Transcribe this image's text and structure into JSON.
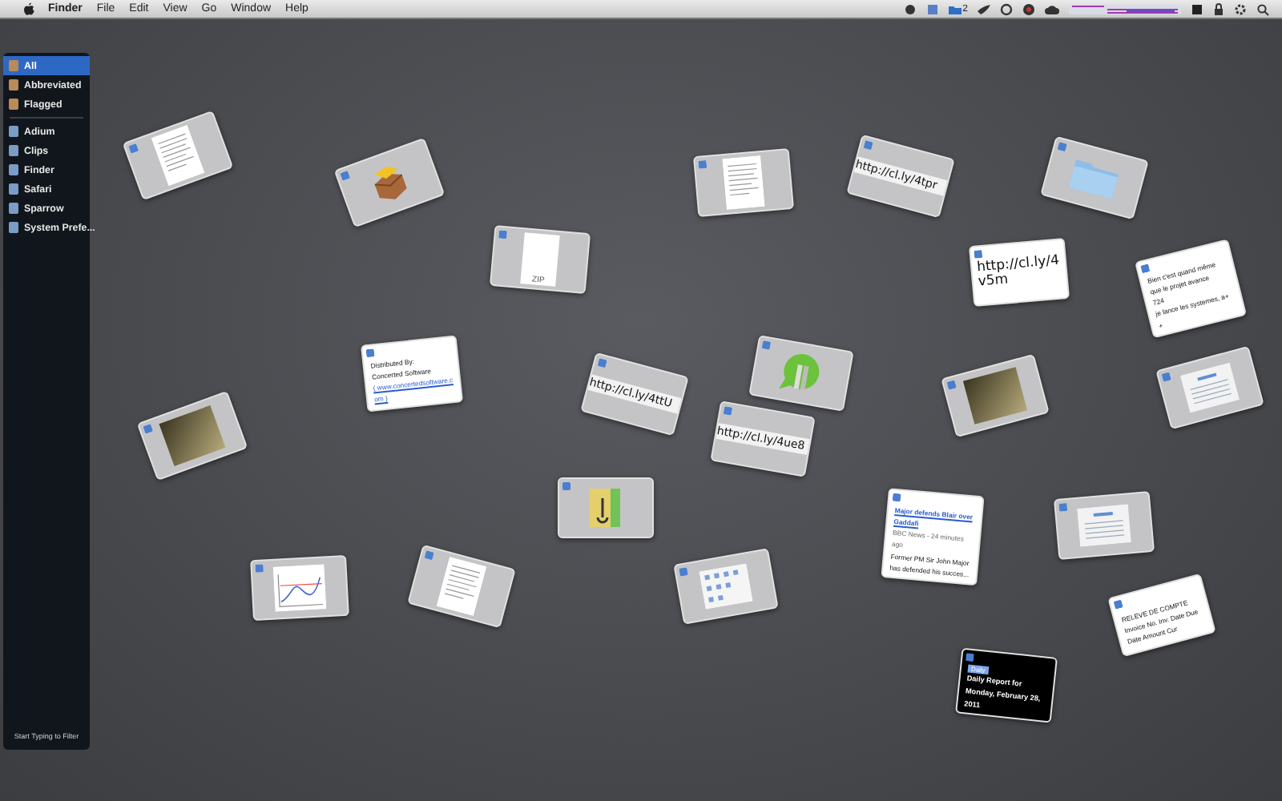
{
  "menu_bar": {
    "app": "Finder",
    "menus": [
      "File",
      "Edit",
      "View",
      "Go",
      "Window",
      "Help"
    ],
    "status_badge": "2"
  },
  "sidebar": {
    "groups": [
      [
        {
          "label": "All",
          "selected": true
        },
        {
          "label": "Abbreviated",
          "selected": false
        },
        {
          "label": "Flagged",
          "selected": false
        }
      ],
      [
        {
          "label": "Adium",
          "selected": false
        },
        {
          "label": "Clips",
          "selected": false
        },
        {
          "label": "Finder",
          "selected": false
        },
        {
          "label": "Safari",
          "selected": false
        },
        {
          "label": "Sparrow",
          "selected": false
        },
        {
          "label": "System Prefe..."
        }
      ]
    ],
    "footer": "Start Typing to Filter"
  },
  "clips": [
    {
      "kind": "document"
    },
    {
      "kind": "package"
    },
    {
      "kind": "zip",
      "caption": "ZIP"
    },
    {
      "kind": "document"
    },
    {
      "kind": "url",
      "text": "http://cl.ly/4tpr"
    },
    {
      "kind": "folder"
    },
    {
      "kind": "bigurl",
      "text": "http://cl.ly/4v5m"
    },
    {
      "kind": "note",
      "lines": [
        "Bien c'est quand même",
        "que le projet avance",
        "724",
        "je lance les systemes, a+",
        "+"
      ]
    },
    {
      "kind": "note",
      "lines": [
        "Distributed By:",
        "Concerted Software"
      ],
      "link": "( www.concertedsoftware.c",
      "tail": "om )"
    },
    {
      "kind": "url",
      "text": "http://cl.ly/4ttU"
    },
    {
      "kind": "chat"
    },
    {
      "kind": "photo"
    },
    {
      "kind": "screenshot"
    },
    {
      "kind": "photo"
    },
    {
      "kind": "url",
      "text": "http://cl.ly/4ue8"
    },
    {
      "kind": "app"
    },
    {
      "kind": "news",
      "headline": "Major defends Blair over Gaddafi",
      "source": "BBC News - 24 minutes ago",
      "body": "Former PM Sir John Major has defended his succes..."
    },
    {
      "kind": "screenshot"
    },
    {
      "kind": "chart"
    },
    {
      "kind": "document"
    },
    {
      "kind": "grid"
    },
    {
      "kind": "invoice",
      "title": "RELEVE DE COMPTE",
      "lines": [
        "Invoice No. Inv. Date Due",
        "Date Amount Cur"
      ]
    },
    {
      "kind": "report",
      "tag": "Daily",
      "text": "Daily Report for Monday, February 28, 2011"
    }
  ]
}
